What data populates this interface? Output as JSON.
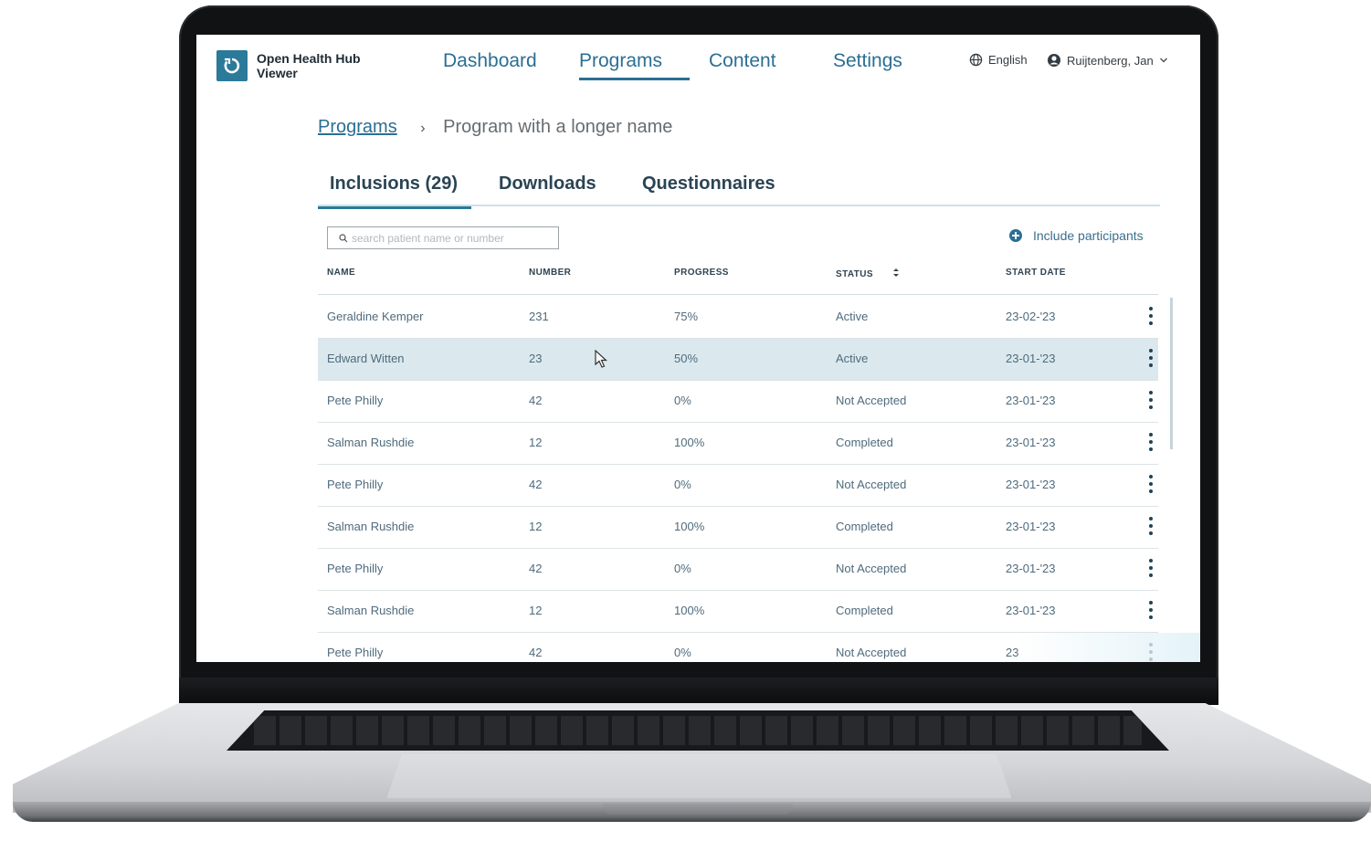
{
  "app": {
    "name": "Open Health Hub Viewer"
  },
  "nav": {
    "items": [
      {
        "label": "Dashboard",
        "active": false
      },
      {
        "label": "Programs",
        "active": true
      },
      {
        "label": "Content",
        "active": false
      },
      {
        "label": "Settings",
        "active": false
      }
    ],
    "language": "English",
    "user": "Ruijtenberg, Jan"
  },
  "breadcrumb": {
    "parent": "Programs",
    "separator": "›",
    "current": "Program with a longer name"
  },
  "tabs": [
    {
      "label": "Inclusions (29)",
      "active": true
    },
    {
      "label": "Downloads",
      "active": false
    },
    {
      "label": "Questionnaires",
      "active": false
    }
  ],
  "search": {
    "placeholder": "search patient name or number",
    "value": ""
  },
  "actions": {
    "include_label": "Include participants"
  },
  "table": {
    "columns": [
      "NAME",
      "NUMBER",
      "PROGRESS",
      "STATUS",
      "START DATE"
    ],
    "rows": [
      {
        "name": "Geraldine Kemper",
        "number": "231",
        "progress": "75%",
        "status": "Active",
        "start": "23-02-'23"
      },
      {
        "name": "Edward Witten",
        "number": "23",
        "progress": "50%",
        "status": "Active",
        "start": "23-01-'23",
        "selected": true
      },
      {
        "name": "Pete Philly",
        "number": "42",
        "progress": "0%",
        "status": "Not Accepted",
        "start": "23-01-'23"
      },
      {
        "name": "Salman Rushdie",
        "number": "12",
        "progress": "100%",
        "status": "Completed",
        "start": "23-01-'23"
      },
      {
        "name": "Pete Philly",
        "number": "42",
        "progress": "0%",
        "status": "Not Accepted",
        "start": "23-01-'23"
      },
      {
        "name": "Salman Rushdie",
        "number": "12",
        "progress": "100%",
        "status": "Completed",
        "start": "23-01-'23"
      },
      {
        "name": "Pete Philly",
        "number": "42",
        "progress": "0%",
        "status": "Not Accepted",
        "start": "23-01-'23"
      },
      {
        "name": "Salman Rushdie",
        "number": "12",
        "progress": "100%",
        "status": "Completed",
        "start": "23-01-'23"
      },
      {
        "name": "Pete Philly",
        "number": "42",
        "progress": "0%",
        "status": "Not Accepted",
        "start": "23"
      }
    ]
  },
  "icons": {
    "logo": "refresh-circle-icon",
    "language": "globe-icon",
    "user": "user-circle-icon",
    "user_menu": "chevron-down-icon",
    "search": "search-icon",
    "include": "plus-circle-icon",
    "sort": "sort-icon",
    "row_menu": "kebab-menu-icon"
  },
  "colors": {
    "brand": "#2b7a99",
    "link": "#2b6f93",
    "selected_row": "#dbe9ee"
  }
}
